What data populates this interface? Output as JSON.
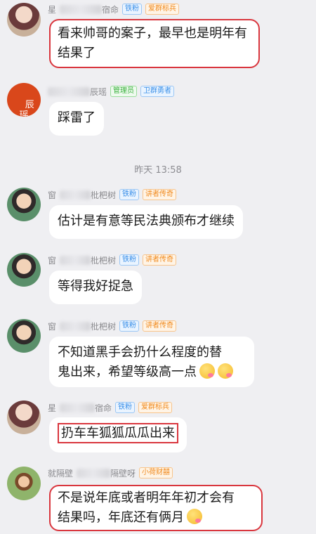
{
  "timestamp": "昨天 13:58",
  "badges": {
    "iron_fan": "铁粉",
    "admin": "管理员",
    "flag_soldier": "爱群标兵",
    "guard": "卫群勇者",
    "lecturer": "讲者传奇",
    "lotus": "小荷财囍"
  },
  "messages": [
    {
      "name_prefix": "星",
      "name_suffix": "宿命",
      "text": "看来帅哥的案子，最早也是明年有结果了"
    },
    {
      "name_prefix": "",
      "name_suffix": "辰瑶",
      "avatar_text": "辰\n瑶",
      "text": "踩雷了"
    },
    {
      "name_prefix": "窗",
      "name_suffix": "枇杷树",
      "text": "估计是有意等民法典颁布才继续"
    },
    {
      "name_prefix": "窗",
      "name_suffix": "枇杷树",
      "text": "等得我好捉急"
    },
    {
      "name_prefix": "窗",
      "name_suffix": "枇杷树",
      "text_line1": "不知道黑手会扔什么程度的替",
      "text_line2": "鬼出来，希望等级高一点"
    },
    {
      "name_prefix": "星",
      "name_suffix": "宿命",
      "text": "扔车车狐狐瓜瓜出来"
    },
    {
      "name_prefix": "就隔壁",
      "name_suffix": "隔壁呀",
      "text_line1": "不是说年底或者明年年初才会有",
      "text_line2": "结果吗，年底还有俩月"
    }
  ],
  "icons": [
    "avatar-woman-costume",
    "avatar-chenyao",
    "avatar-man-smiling",
    "emoji-drool",
    "emoji-sweat-smile"
  ]
}
